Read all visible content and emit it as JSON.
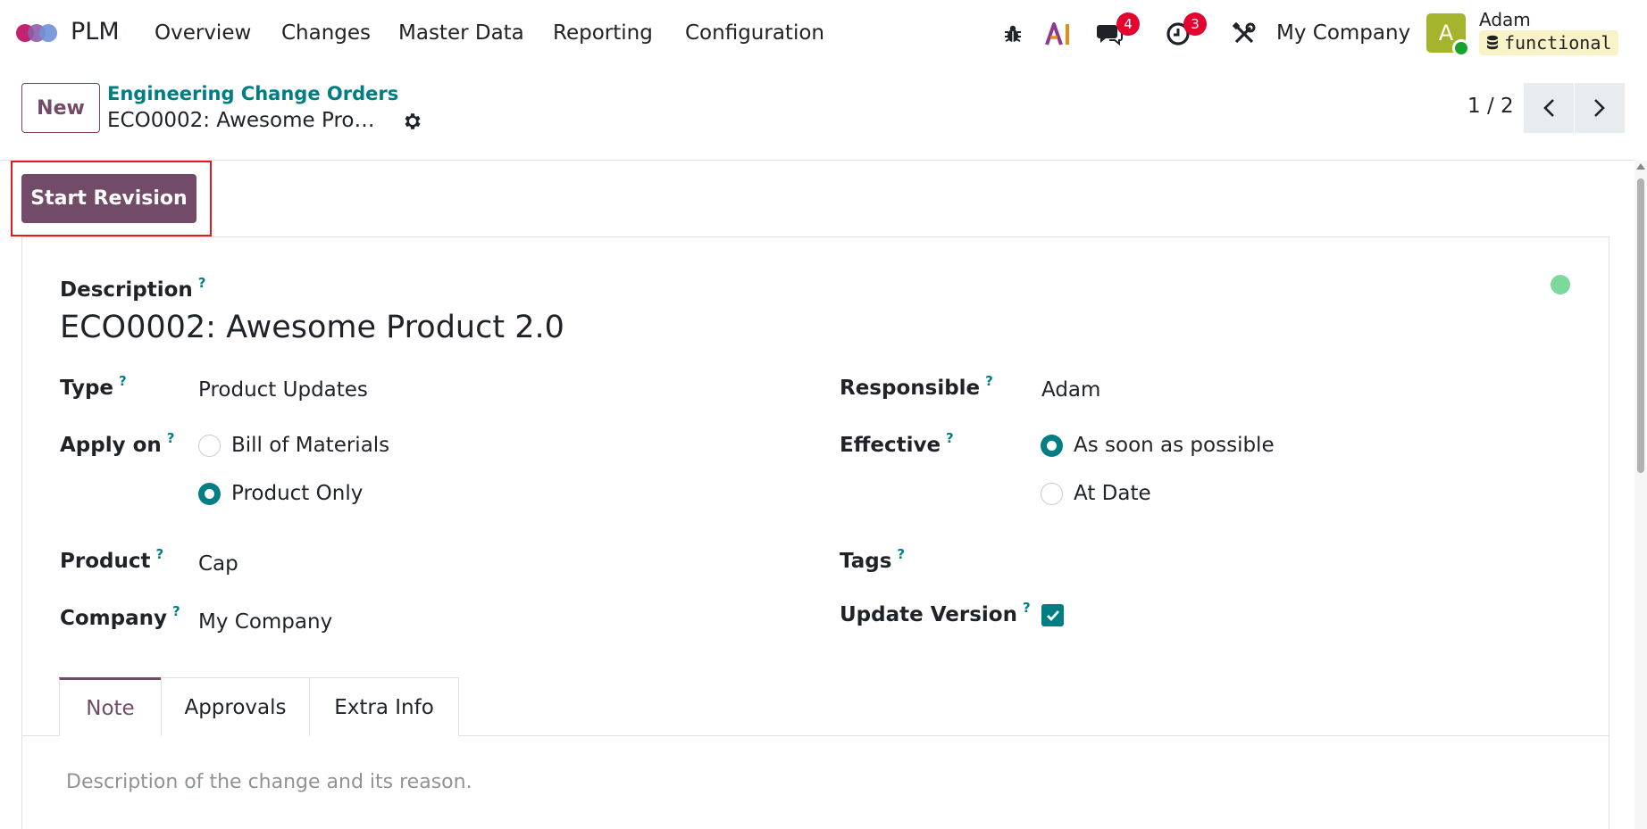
{
  "navbar": {
    "app_name": "PLM",
    "menu": [
      "Overview",
      "Changes",
      "Master Data",
      "Reporting",
      "Configuration"
    ],
    "icons": [
      "bug-icon",
      "ai-icon",
      "chat-icon",
      "clock-icon",
      "tools-icon"
    ],
    "messages_count": "4",
    "activities_count": "3",
    "company": "My Company",
    "user": {
      "initial": "A",
      "name": "Adam",
      "database": "functional"
    }
  },
  "control_panel": {
    "new_label": "New",
    "breadcrumb_parent": "Engineering Change Orders",
    "breadcrumb_current": "ECO0002: Awesome Product 2.0",
    "pager": "1 / 2"
  },
  "status_bar": {
    "start_revision_label": "Start Revision"
  },
  "form": {
    "description_label": "Description",
    "title": "ECO0002: Awesome Product 2.0",
    "help_mark": "?",
    "type_label": "Type",
    "type_value": "Product Updates",
    "apply_on_label": "Apply on",
    "apply_on_options": [
      {
        "label": "Bill of Materials",
        "selected": false
      },
      {
        "label": "Product Only",
        "selected": true
      }
    ],
    "product_label": "Product",
    "product_value": "Cap",
    "company_label": "Company",
    "company_value": "My Company",
    "responsible_label": "Responsible",
    "responsible_value": "Adam",
    "effective_label": "Effective",
    "effective_options": [
      {
        "label": "As soon as possible",
        "selected": true
      },
      {
        "label": "At Date",
        "selected": false
      }
    ],
    "tags_label": "Tags",
    "update_version_label": "Update Version",
    "update_version_checked": true
  },
  "tabs": {
    "items": [
      "Note",
      "Approvals",
      "Extra Info"
    ],
    "active": "Note"
  },
  "note": {
    "placeholder": "Description of the change and its reason."
  },
  "colors": {
    "primary": "#714b67",
    "accent": "#017e84",
    "badge": "#e4022e",
    "status_dot": "#7cd99b",
    "highlight": "#e01b1b"
  }
}
